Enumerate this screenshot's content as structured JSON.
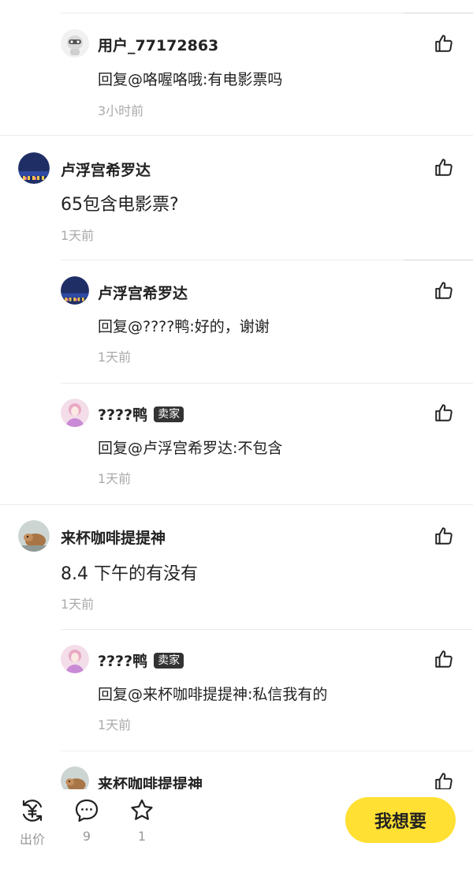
{
  "comments": [
    {
      "user": "用户_77172863",
      "text": "回复@咯喔咯哦:有电影票吗",
      "time": "3小时前",
      "badge": ""
    },
    {
      "user": "卢浮宫希罗达",
      "text": "65包含电影票?",
      "time": "1天前",
      "badge": ""
    },
    {
      "user": "卢浮宫希罗达",
      "text": "回复@????鸭:好的，谢谢",
      "time": "1天前",
      "badge": ""
    },
    {
      "user": "????鸭",
      "text": "回复@卢浮宫希罗达:不包含",
      "time": "1天前",
      "badge": "卖家"
    },
    {
      "user": "来杯咖啡提提神",
      "text": "8.4 下午的有没有",
      "time": "1天前",
      "badge": ""
    },
    {
      "user": "????鸭",
      "text": "回复@来杯咖啡提提神:私信我有的",
      "time": "1天前",
      "badge": "卖家"
    },
    {
      "user": "来杯咖啡提提神",
      "text": "",
      "time": "",
      "badge": ""
    }
  ],
  "bottom_bar": {
    "offer_label": "出价",
    "comments_count": "9",
    "favorites_count": "1",
    "want_label": "我想要"
  },
  "colors": {
    "accent": "#ffe033",
    "badge_bg": "#333333",
    "meta_text": "#aaaaaa"
  }
}
